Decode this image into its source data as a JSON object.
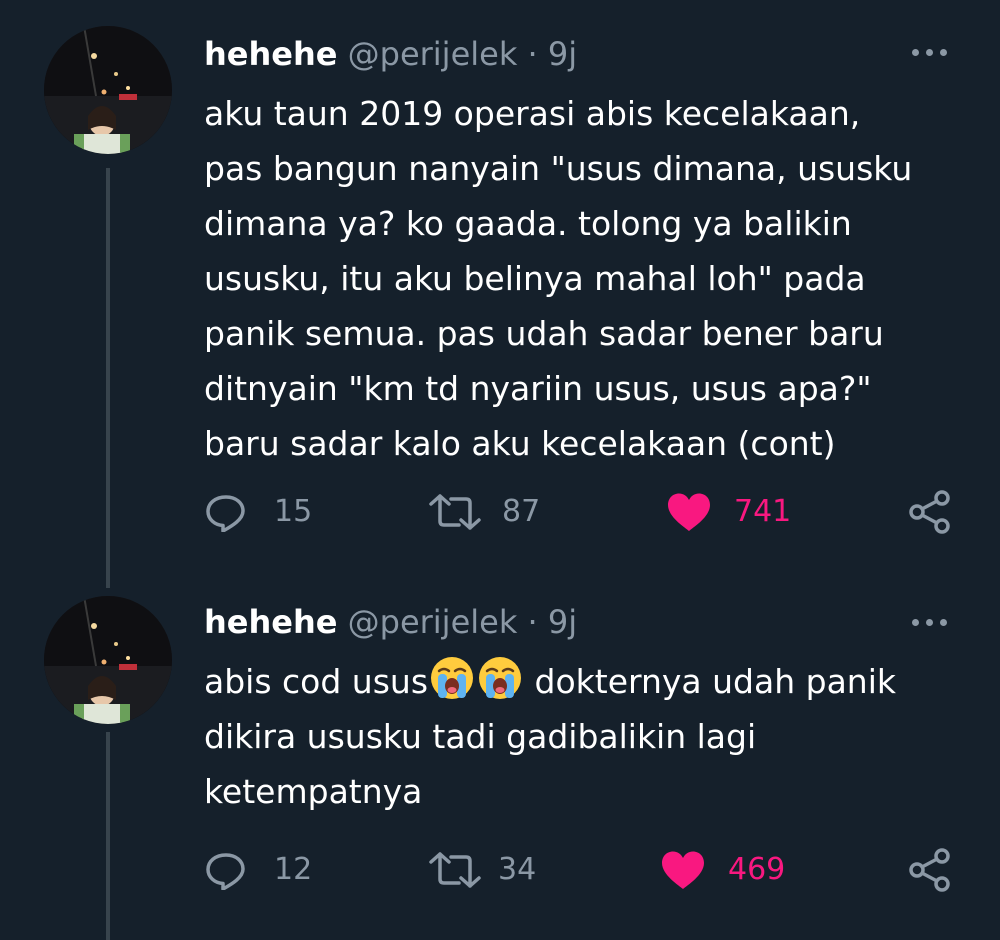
{
  "tweets": [
    {
      "author": {
        "display_name": "hehehe",
        "handle": "@perijelek",
        "separator": "·",
        "time": "9j"
      },
      "text": "aku taun 2019 operasi abis kecelakaan,\npas bangun nanyain \"usus dimana, ususku\ndimana ya? ko gaada. tolong ya balikin\nususku, itu aku belinya mahal loh\" pada\npanik semua. pas udah sadar bener baru\nditnyain \"km td nyariin usus, usus apa?\"\nbaru sadar kalo aku kecelakaan (cont)",
      "stats": {
        "replies": "15",
        "retweets": "87",
        "likes": "741"
      },
      "liked": true
    },
    {
      "author": {
        "display_name": "hehehe",
        "handle": "@perijelek",
        "separator": "·",
        "time": "9j"
      },
      "text_before_emoji": "abis cod usus",
      "emojis": [
        "loudly-crying-face-icon",
        "loudly-crying-face-icon"
      ],
      "text_after_emoji": " dokternya udah panik\ndikira ususku tadi gadibalikin lagi\nketempatnya",
      "stats": {
        "replies": "12",
        "retweets": "34",
        "likes": "469"
      },
      "liked": true
    }
  ],
  "icons": {
    "reply": "reply-icon",
    "retweet": "retweet-icon",
    "like": "heart-icon",
    "share": "share-icon",
    "more": "more-options-icon"
  },
  "colors": {
    "background": "#15202b",
    "secondary_text": "#8b98a5",
    "like": "#f91880",
    "thread_line": "#38444d"
  }
}
